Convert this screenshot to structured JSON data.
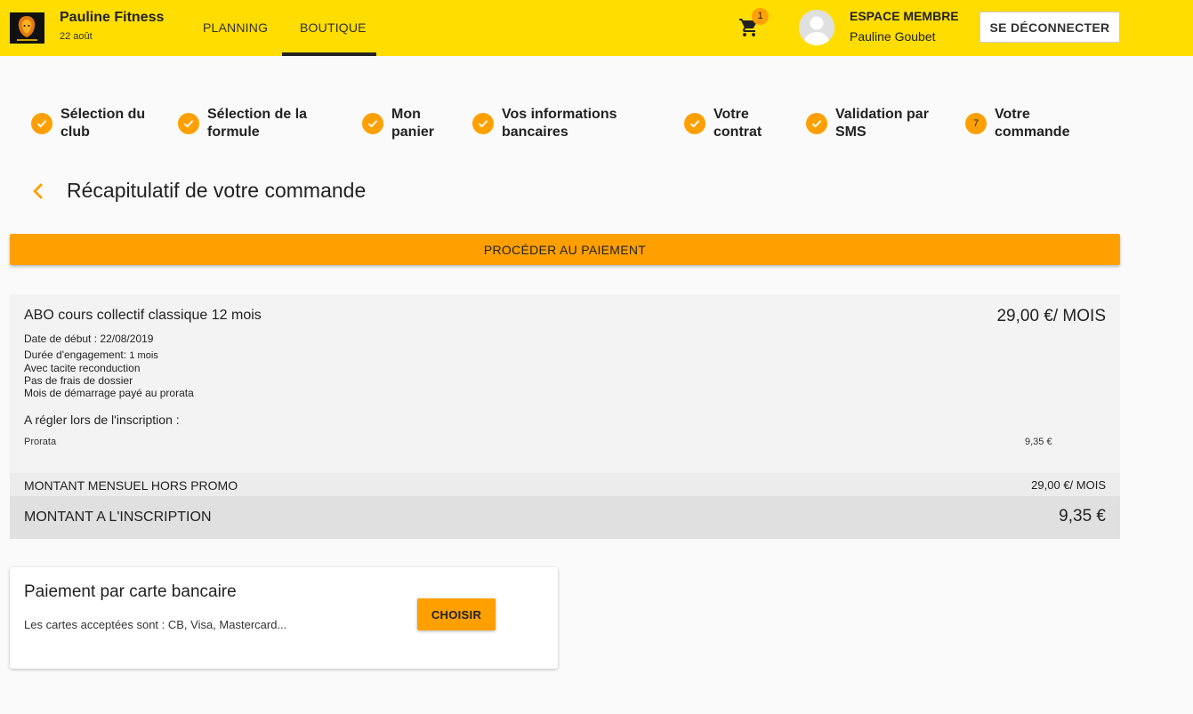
{
  "header": {
    "brand_title": "Pauline Fitness",
    "brand_date": "22 août",
    "nav": [
      {
        "label": "PLANNING",
        "active": false
      },
      {
        "label": "BOUTIQUE",
        "active": true
      }
    ],
    "cart_icon": "shopping-cart-icon",
    "cart_count": "1",
    "member_title": "ESPACE MEMBRE",
    "member_name": "Pauline Goubet",
    "logout_label": "SE DÉCONNECTER"
  },
  "stepper": {
    "steps": [
      {
        "line1": "Sélection du",
        "line2": "club",
        "status": "done",
        "number": ""
      },
      {
        "line1": "Sélection de la",
        "line2": "formule",
        "status": "done",
        "number": ""
      },
      {
        "line1": "Mon",
        "line2": "panier",
        "status": "done",
        "number": ""
      },
      {
        "line1": "Vos informations",
        "line2": "bancaires",
        "status": "done",
        "number": ""
      },
      {
        "line1": "Votre",
        "line2": "contrat",
        "status": "done",
        "number": ""
      },
      {
        "line1": "Validation par",
        "line2": "SMS",
        "status": "done",
        "number": ""
      },
      {
        "line1": "Votre",
        "line2": "commande",
        "status": "current",
        "number": "7"
      }
    ],
    "accent_color": "#ffa000"
  },
  "page": {
    "title": "Récapitulatif de votre commande",
    "pay_label": "PROCÉDER AU PAIEMENT"
  },
  "summary": {
    "product_name": "ABO cours collectif classique 12 mois",
    "product_price": "29,00 €/ MOIS",
    "start_label": "Date de début : ",
    "start_value": "22/08/2019",
    "duration_label": "Durée d'engagement: ",
    "duration_value": "1 mois",
    "lines": [
      "Avec tacite reconduction",
      "Pas de frais de dossier",
      "Mois de démarrage payé au prorata"
    ],
    "due_title": "A régler lors de l'inscription :",
    "prorata_label": "Prorata",
    "prorata_value": "9,35 €",
    "monthly_label": "MONTANT MENSUEL HORS PROMO",
    "monthly_value": "29,00 €/ MOIS",
    "total_label": "MONTANT A L'INSCRIPTION",
    "total_value": "9,35 €"
  },
  "payment_card": {
    "title": "Paiement par carte bancaire",
    "description": "Les cartes acceptées sont : CB, Visa, Mastercard...",
    "choose_label": "CHOISIR"
  },
  "colors": {
    "header_bg": "#ffdd00",
    "accent": "#ffa000"
  }
}
